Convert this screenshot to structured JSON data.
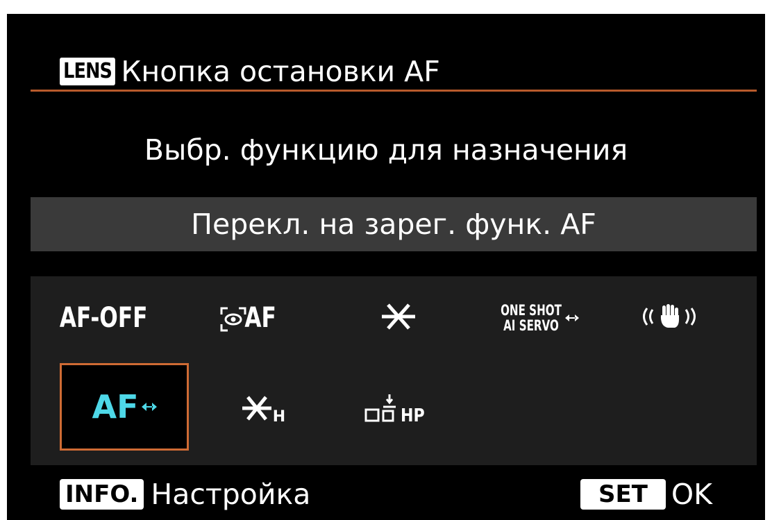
{
  "header": {
    "badge": "LENS",
    "title": "Кнопка остановки AF"
  },
  "prompt": "Выбр. функцию для назначения",
  "current_function": "Перекл. на зарег. функ. AF",
  "options": {
    "af_off": "AF-OFF",
    "af_eye_icon_suffix": "AF",
    "one_shot": "ONE SHOT",
    "ai_servo": "AI SERVO",
    "af_switch": "AF",
    "ae_lock_hold_sub": "H",
    "home_position_sub": "HP"
  },
  "icons": {
    "af_eye_detect": "eye-detection-af-icon",
    "ae_lock": "asterisk-ae-lock-icon",
    "one_shot_ai_servo": "one-shot-ai-servo-switch-icon",
    "image_stabilizer": "image-stabilizer-hand-icon",
    "af_switch": "af-start-switch-icon",
    "ae_lock_hold": "ae-lock-hold-icon",
    "home_position": "home-position-icon"
  },
  "footer": {
    "info_badge": "INFO.",
    "info_label": "Настройка",
    "set_badge": "SET",
    "set_label": "OK"
  },
  "colors": {
    "background": "#000000",
    "accent_line": "#b85a2c",
    "selection_border": "#cf6b34",
    "selected_text": "#4ed8e8",
    "current_bar": "#3a3a3a",
    "grid_panel": "#1e1e1e"
  }
}
